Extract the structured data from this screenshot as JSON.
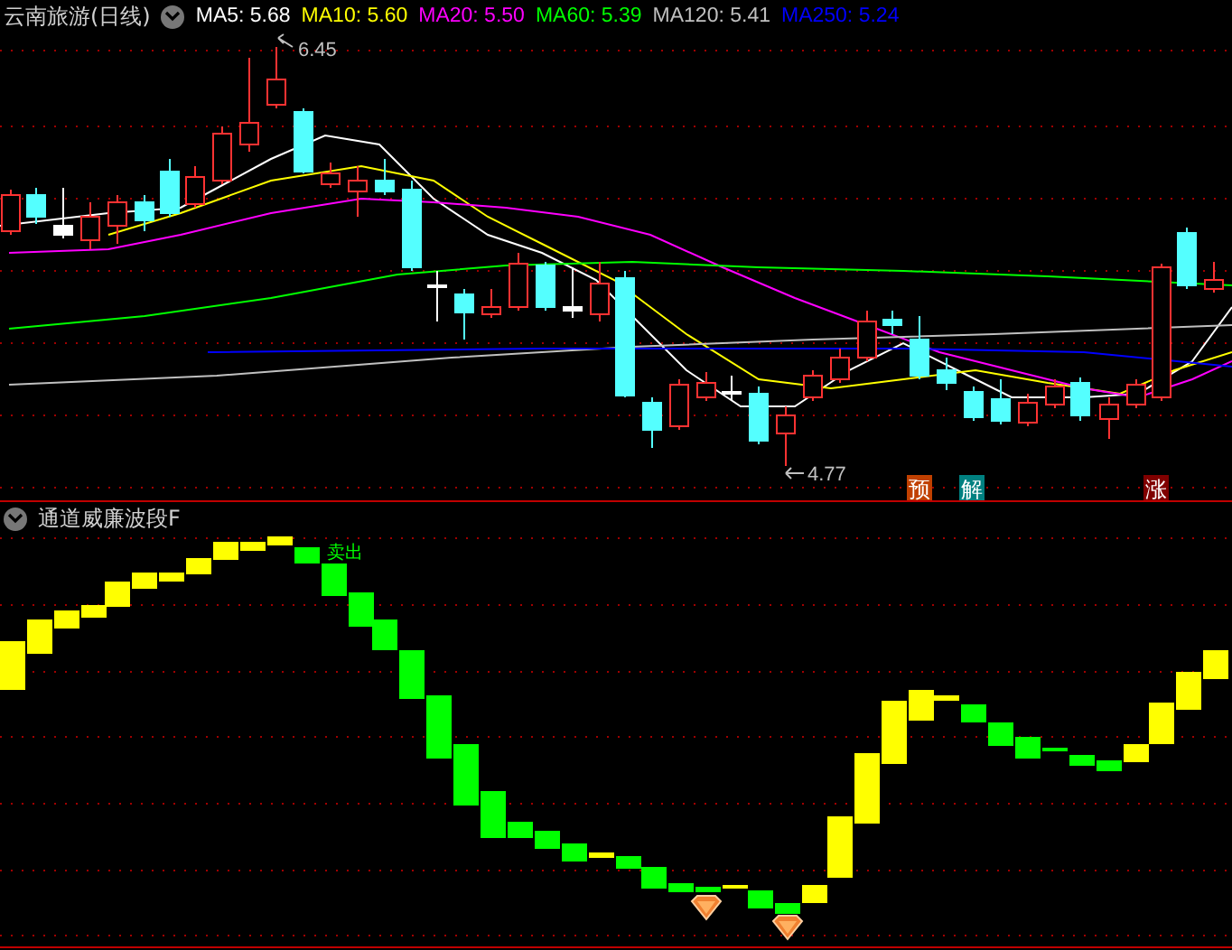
{
  "chart_header": {
    "title": "云南旅游(日线)",
    "indicators": [
      {
        "label": "MA5: 5.68",
        "color": "#ffffff"
      },
      {
        "label": "MA10: 5.60",
        "color": "#ffff00"
      },
      {
        "label": "MA20: 5.50",
        "color": "#ff00ff"
      },
      {
        "label": "MA60: 5.39",
        "color": "#00ff00"
      },
      {
        "label": "MA120: 5.41",
        "color": "#c0c0c0"
      },
      {
        "label": "MA250: 5.24",
        "color": "#0000ff"
      }
    ]
  },
  "price_chart": {
    "high_label": "6.45",
    "low_label": "4.77",
    "signals": [
      {
        "text": "预",
        "color": "#c04000"
      },
      {
        "text": "解",
        "color": "#008080"
      },
      {
        "text": "涨",
        "color": "#800000"
      }
    ]
  },
  "indicator_panel": {
    "title": "通道威廉波段F",
    "sell_label": "卖出"
  }
}
